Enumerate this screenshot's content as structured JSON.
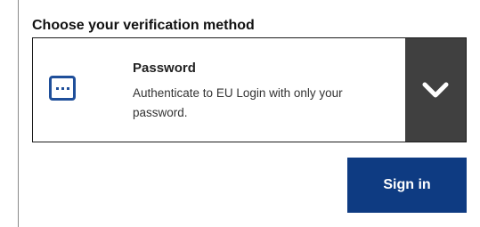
{
  "heading": "Choose your verification method",
  "method": {
    "icon": "password-dots-icon",
    "title": "Password",
    "description": "Authenticate to EU Login with only your password.",
    "toggle_icon": "chevron-down-icon"
  },
  "actions": {
    "sign_in_label": "Sign in"
  },
  "colors": {
    "brand_blue": "#0e3b82",
    "icon_blue": "#1f4f9a",
    "toggle_bg": "#404040",
    "border": "#1c1c1c"
  }
}
